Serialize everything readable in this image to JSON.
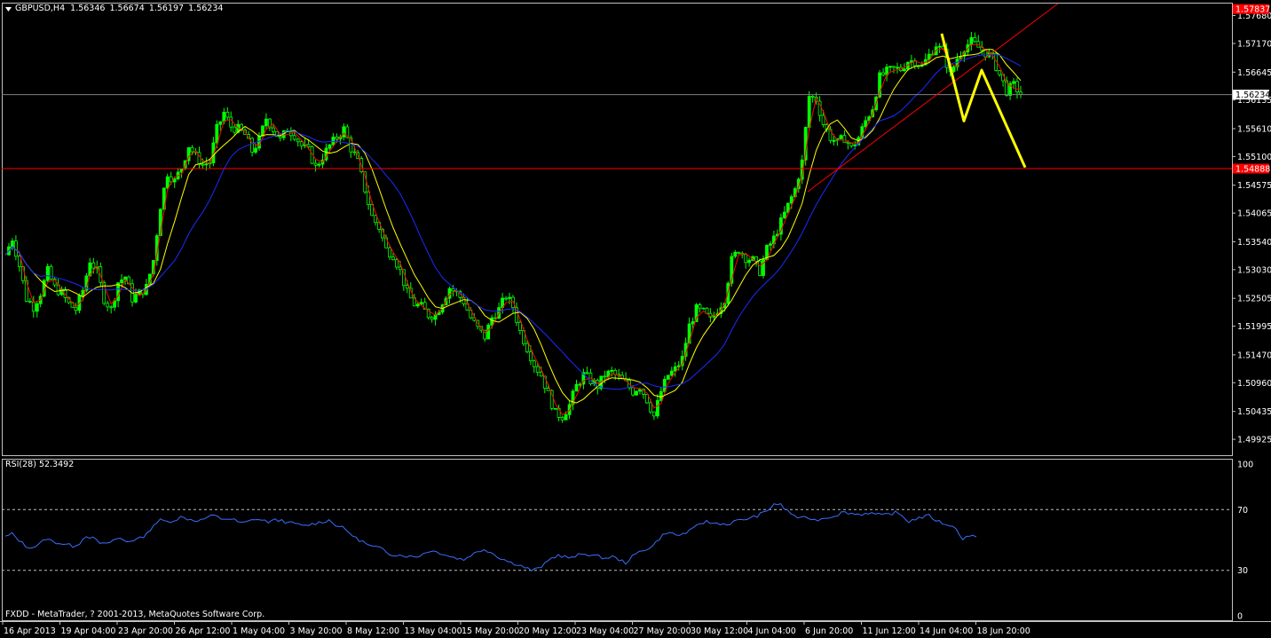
{
  "window": {
    "header_symbol": "GBPUSD,H4",
    "header_ohlc": [
      "1.56346",
      "1.56674",
      "1.56197",
      "1.56234"
    ],
    "copyright": "FXDD - MetaTrader, ? 2001-2013, MetaQuotes Software Corp."
  },
  "colors": {
    "background": "#000000",
    "frame": "#c0c0c0",
    "bull_candle": "#00ff00",
    "ma_fast": "#ff0000",
    "ma_medium": "#ffff00",
    "ma_slow": "#1a2cff",
    "trendline": "#ff0000",
    "support_line": "#ff0000",
    "projection": "#ffff00",
    "rsi_line": "#3a6eff",
    "rsi_levels": "#c0c0c0",
    "price_label_bg": "#ff0000",
    "current_price_bg": "#ffffff"
  },
  "chart_data": [
    {
      "type": "candlestick",
      "symbol": "GBPUSD",
      "timeframe": "H4",
      "ylim": [
        1.4965,
        1.579
      ],
      "y_ticks": [
        "1.57680",
        "1.57170",
        "1.56645",
        "1.56135",
        "1.55610",
        "1.55100",
        "1.54575",
        "1.54065",
        "1.53540",
        "1.53030",
        "1.52505",
        "1.51995",
        "1.51470",
        "1.50960",
        "1.50435",
        "1.49925"
      ],
      "x_ticks": [
        "16 Apr 2013",
        "19 Apr 04:00",
        "23 Apr 20:00",
        "26 Apr 12:00",
        "1 May 04:00",
        "3 May 20:00",
        "8 May 12:00",
        "13 May 04:00",
        "15 May 20:00",
        "20 May 12:00",
        "23 May 04:00",
        "27 May 20:00",
        "30 May 12:00",
        "4 Jun 04:00",
        "6 Jun 20:00",
        "11 Jun 12:00",
        "14 Jun 04:00",
        "18 Jun 20:00"
      ],
      "current_price": "1.56234",
      "support_level": 1.5488,
      "support_label": "1.54888",
      "top_label": "1.57837",
      "close_path": [
        1.533,
        1.536,
        1.531,
        1.525,
        1.5235,
        1.526,
        1.53,
        1.527,
        1.526,
        1.524,
        1.523,
        1.5265,
        1.532,
        1.53,
        1.525,
        1.523,
        1.528,
        1.529,
        1.525,
        1.526,
        1.527,
        1.532,
        1.542,
        1.548,
        1.5465,
        1.549,
        1.553,
        1.551,
        1.5495,
        1.55,
        1.556,
        1.559,
        1.5565,
        1.556,
        1.555,
        1.552,
        1.554,
        1.558,
        1.556,
        1.554,
        1.556,
        1.555,
        1.553,
        1.552,
        1.549,
        1.551,
        1.553,
        1.5545,
        1.556,
        1.5525,
        1.55,
        1.545,
        1.54,
        1.538,
        1.534,
        1.533,
        1.53,
        1.526,
        1.524,
        1.5235,
        1.522,
        1.522,
        1.5245,
        1.527,
        1.526,
        1.5245,
        1.5215,
        1.5195,
        1.518,
        1.5215,
        1.523,
        1.5255,
        1.5235,
        1.519,
        1.516,
        1.513,
        1.511,
        1.5075,
        1.504,
        1.5035,
        1.5055,
        1.509,
        1.511,
        1.51,
        1.509,
        1.511,
        1.5115,
        1.5105,
        1.5095,
        1.508,
        1.509,
        1.5065,
        1.5035,
        1.508,
        1.511,
        1.512,
        1.514,
        1.52,
        1.523,
        1.5225,
        1.521,
        1.523,
        1.525,
        1.532,
        1.534,
        1.5325,
        1.532,
        1.53,
        1.534,
        1.536,
        1.539,
        1.542,
        1.545,
        1.55,
        1.562,
        1.5615,
        1.557,
        1.5545,
        1.5535,
        1.5545,
        1.5525,
        1.5545,
        1.5575,
        1.56,
        1.5655,
        1.5665,
        1.567,
        1.567,
        1.5685,
        1.5685,
        1.5675,
        1.5695,
        1.5715,
        1.57,
        1.566,
        1.569,
        1.571,
        1.572,
        1.571,
        1.57,
        1.569,
        1.566,
        1.563,
        1.564,
        1.5625
      ],
      "projection_path": [
        [
          1.5735,
          1.5575,
          1.5668,
          1.549
        ]
      ],
      "overlays": [
        "moving-average-fast",
        "moving-average-medium",
        "moving-average-slow",
        "trendline",
        "support-line",
        "projection-zigzag"
      ]
    },
    {
      "type": "line",
      "indicator": "RSI",
      "header_label": "RSI(28) 52.3492",
      "ylim": [
        0,
        100
      ],
      "y_ticks": [
        "100",
        "70",
        "30",
        "0"
      ],
      "levels": [
        70,
        30
      ],
      "values": [
        52,
        54,
        50,
        46,
        45,
        47,
        51,
        49,
        48,
        47,
        46,
        48,
        53,
        51,
        48,
        47,
        50,
        51,
        49,
        50,
        51,
        54,
        60,
        63,
        62,
        63,
        65,
        64,
        63,
        63,
        65,
        66,
        64,
        64,
        63,
        61,
        62,
        64,
        63,
        62,
        63,
        63,
        61,
        61,
        59,
        60,
        61,
        62,
        63,
        60,
        58,
        55,
        51,
        49,
        46,
        45,
        44,
        41,
        40,
        40,
        39,
        39,
        41,
        43,
        42,
        41,
        39,
        38,
        37,
        40,
        42,
        44,
        42,
        39,
        37,
        35,
        34,
        32,
        30,
        31,
        34,
        38,
        40,
        39,
        38,
        40,
        41,
        40,
        39,
        38,
        39,
        37,
        35,
        39,
        42,
        44,
        46,
        51,
        55,
        54,
        53,
        55,
        57,
        61,
        62,
        61,
        61,
        60,
        62,
        63,
        64,
        65,
        67,
        69,
        74,
        73,
        69,
        66,
        64,
        65,
        63,
        64,
        65,
        66,
        68,
        68,
        67,
        67,
        68,
        67,
        66,
        67,
        68,
        66,
        62,
        64,
        65,
        66,
        63,
        61,
        60,
        57,
        51,
        53,
        52
      ]
    }
  ]
}
